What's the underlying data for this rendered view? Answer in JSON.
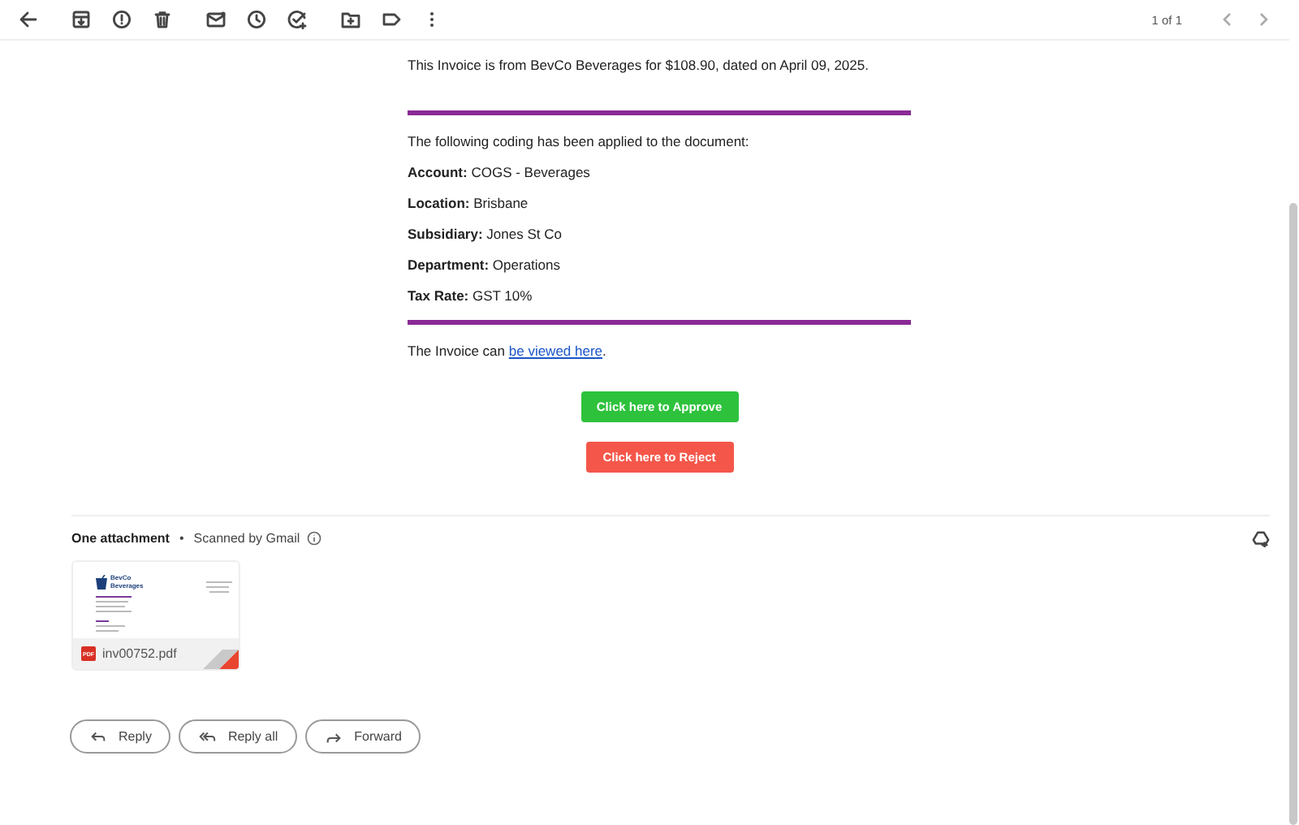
{
  "toolbar": {
    "counter": "1 of 1"
  },
  "message": {
    "intro": "This Invoice is from BevCo Beverages for $108.90, dated on April 09, 2025.",
    "coding_heading": "The following coding has been applied to the document:",
    "fields": [
      {
        "label": "Account:",
        "value": "COGS - Beverages"
      },
      {
        "label": "Location:",
        "value": "Brisbane"
      },
      {
        "label": "Subsidiary:",
        "value": "Jones St Co"
      },
      {
        "label": "Department:",
        "value": "Operations"
      },
      {
        "label": "Tax Rate:",
        "value": "GST 10%"
      }
    ],
    "view_line": {
      "before": "The Invoice can ",
      "link": "be viewed here",
      "after": "."
    },
    "buttons": [
      {
        "label": "Click here to Approve",
        "kind": "approve"
      },
      {
        "label": "Click here to Reject",
        "kind": "reject"
      }
    ]
  },
  "attachments": {
    "title": "One attachment",
    "separator": "•",
    "scan_note": "Scanned by Gmail",
    "files": [
      {
        "name": "inv00752.pdf",
        "type_badge": "PDF",
        "logo_name": "BevCo",
        "logo_sub": "Beverages"
      }
    ]
  },
  "reply_actions": [
    {
      "label": "Reply",
      "kind": "reply"
    },
    {
      "label": "Reply all",
      "kind": "reply_all"
    },
    {
      "label": "Forward",
      "kind": "forward"
    }
  ]
}
